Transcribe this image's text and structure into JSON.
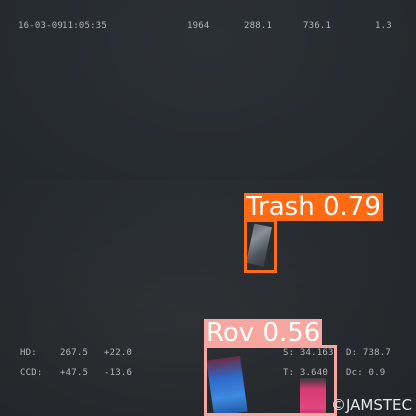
{
  "overlay": {
    "top": {
      "date": "16-03-09",
      "time": "11:05:35",
      "v1": "1964",
      "v2": "288.1",
      "v3": "736.1",
      "v4": "1.3"
    },
    "bottom_left": {
      "row1_label": "HD:",
      "row1_v1": "267.5",
      "row1_v2": "+22.0",
      "row2_label": "CCD:",
      "row2_v1": "+47.5",
      "row2_v2": "-13.6"
    },
    "bottom_right": {
      "row1_a": "S: 34.163",
      "row1_b": "D: 738.7",
      "row2_a": "T: 3.640",
      "row2_b": "Dc: 0.9"
    }
  },
  "detections": [
    {
      "label": "Trash 0.79",
      "class": "Trash",
      "score": 0.79,
      "color": "#ff6a13"
    },
    {
      "label": "Rov 0.56",
      "class": "Rov",
      "score": 0.56,
      "color": "#f7a6a0"
    }
  ],
  "watermark": "©JAMSTEC"
}
